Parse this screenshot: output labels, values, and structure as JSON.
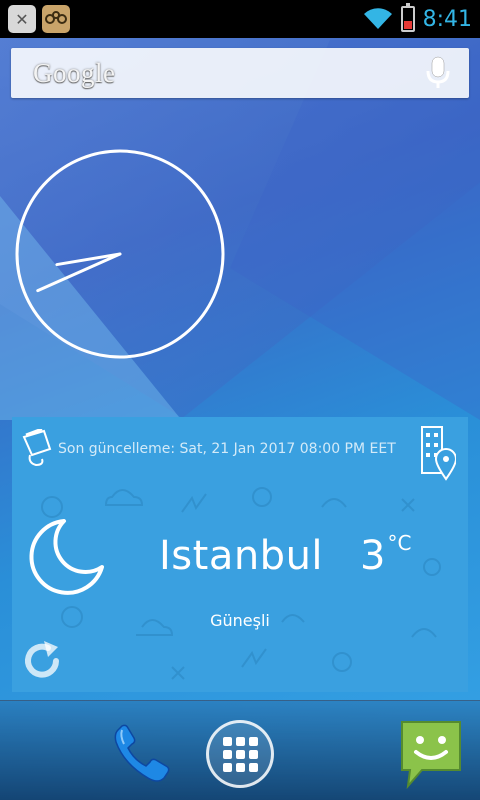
{
  "status_bar": {
    "notifications": [
      "close-icon",
      "bug-icon"
    ],
    "time": "8:41",
    "wifi": "wifi-icon",
    "battery_level": 0.35,
    "colors": {
      "clock": "#33b5e5",
      "battery_low": "#e53935"
    }
  },
  "search": {
    "logo": "Google",
    "mic_icon": "microphone-icon"
  },
  "clock_widget": {
    "hour": 8,
    "minute": 41,
    "icon": "analog-clock"
  },
  "weather": {
    "last_update": "Son güncelleme: Sat, 21 Jan 2017 08:00 PM EET",
    "city": "Istanbul",
    "temperature": "3",
    "unit": "°C",
    "condition": "Güneşli",
    "icons": [
      "bucket-icon",
      "city-location-icon",
      "moon-icon",
      "refresh-icon"
    ],
    "background_color": "#3aa0e0"
  },
  "dock": {
    "items": [
      "phone-icon",
      "app-drawer-icon",
      "messaging-icon"
    ]
  }
}
